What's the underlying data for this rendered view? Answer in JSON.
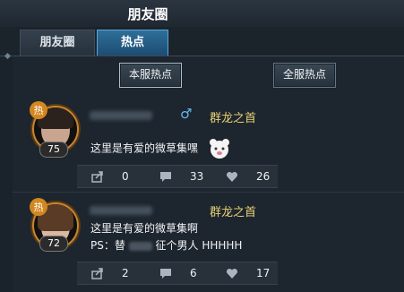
{
  "window": {
    "title": "朋友圈"
  },
  "tabs": [
    {
      "label": "朋友圈",
      "active": false
    },
    {
      "label": "热点",
      "active": true
    }
  ],
  "filters": {
    "server_hot": "本服热点",
    "all_hot": "全服热点"
  },
  "posts": [
    {
      "level": "75",
      "faction": "群龙之首",
      "gender_symbol": "♂",
      "text_line1": "这里是有爱的微草集嘿",
      "share_count": "0",
      "comment_count": "33",
      "like_count": "26"
    },
    {
      "level": "72",
      "faction": "群龙之首",
      "text_line1": "这里是有爱的微草集啊",
      "text_line2_prefix": "PS：替",
      "text_line2_suffix": "征个男人 HHHHH",
      "share_count": "2",
      "comment_count": "6",
      "like_count": "17"
    }
  ],
  "colors": {
    "accent": "#5aa7d8",
    "faction": "#e8cf72",
    "badge": "#c8862e"
  },
  "icons": [
    "share-icon",
    "comment-icon",
    "heart-icon",
    "male-icon",
    "hot-icon",
    "cat-emoji-icon"
  ]
}
